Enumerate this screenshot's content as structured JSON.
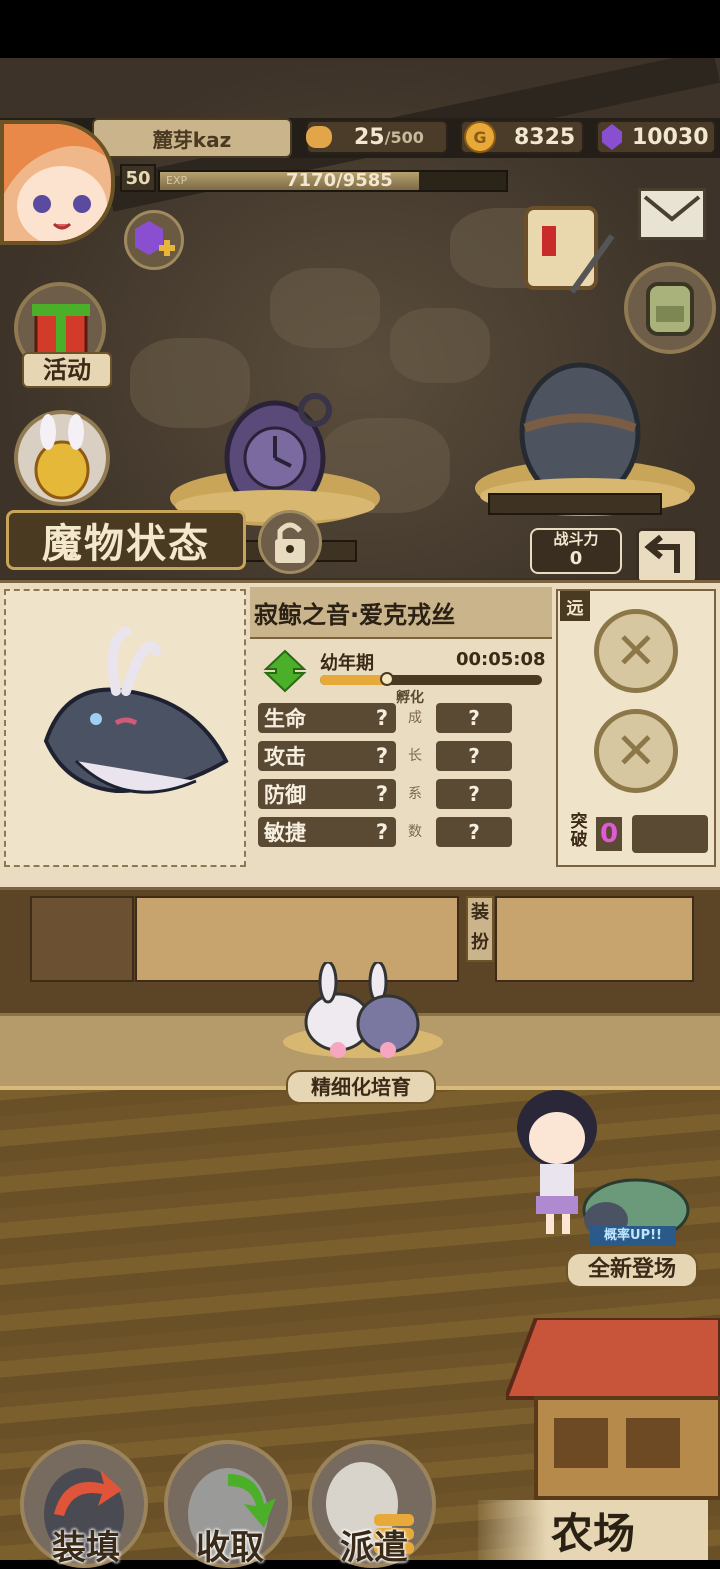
{
  "player": {
    "name": "麓芽kaz",
    "level": "50",
    "exp_label": "EXP",
    "exp_text": "7170/9585",
    "exp_fraction": 0.748
  },
  "resources": {
    "stamina": "25",
    "stamina_max": "/500",
    "gold": "8325",
    "gems": "10030"
  },
  "side_menu": {
    "activity_label": "活动"
  },
  "section": {
    "title": "魔物状态"
  },
  "power": {
    "label": "战斗力",
    "value": "0"
  },
  "monster": {
    "name": "寂鲸之音·爱克戎丝",
    "stage": "幼年期",
    "timer": "00:05:08",
    "stage_progress": 0.3,
    "hatch_label": "孵化",
    "growth_chars": [
      "成",
      "长",
      "系",
      "数"
    ],
    "stats": [
      {
        "label": "生命",
        "value": "?",
        "growth": "?"
      },
      {
        "label": "攻击",
        "value": "?",
        "growth": "?"
      },
      {
        "label": "防御",
        "value": "?",
        "growth": "?"
      },
      {
        "label": "敏捷",
        "value": "?",
        "growth": "?"
      }
    ],
    "range_tag": "远",
    "breakthrough_label": "突破",
    "breakthrough_value": "0"
  },
  "shelf": {
    "equip_label": "装扮"
  },
  "farm": {
    "cultivate_label": "精细化培育",
    "new_arrival": "全新登场",
    "rate_up": "概率UP!!",
    "farm_label": "农场"
  },
  "bottom_nav": {
    "load": "装填",
    "collect": "收取",
    "dispatch": "派遣"
  },
  "colors": {
    "accent_green": "#4caf2a",
    "pink": "#e05ad8",
    "gold": "#e6a93a"
  }
}
